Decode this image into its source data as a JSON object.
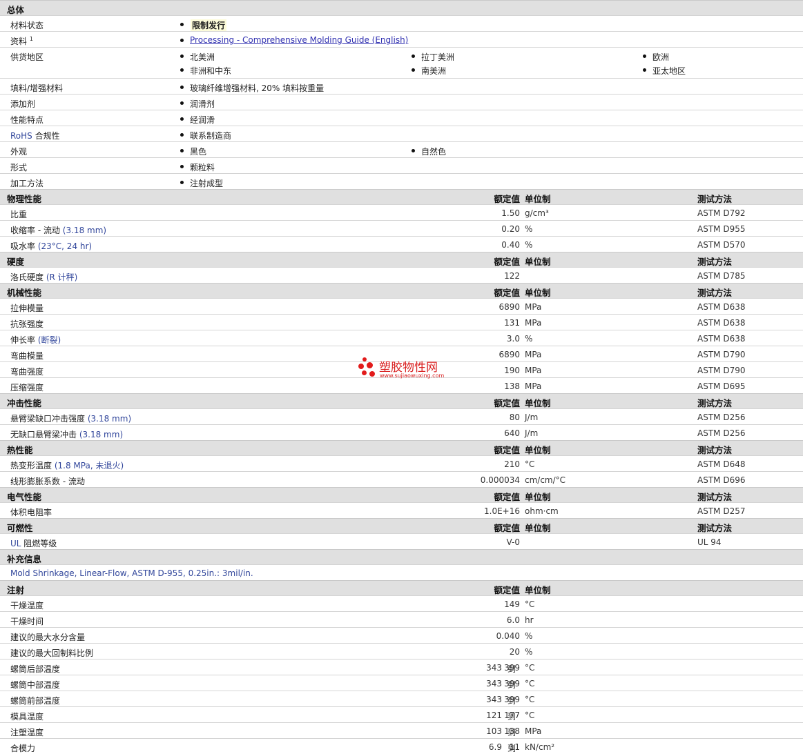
{
  "general": {
    "title": "总体",
    "rows": [
      {
        "label": "材料状态",
        "values": [
          "限制发行"
        ]
      },
      {
        "label": "资料",
        "sup": "1",
        "values": [
          "Processing - Comprehensive Molding Guide (English)"
        ]
      },
      {
        "label": "供货地区",
        "values": [
          "北美洲",
          "拉丁美洲",
          "欧洲",
          "非洲和中东",
          "南美洲",
          "亚太地区"
        ]
      },
      {
        "label": "填料/增强材料",
        "values": [
          "玻璃纤维增强材料, 20% 填料按重量"
        ]
      },
      {
        "label": "添加剂",
        "values": [
          "润滑剂"
        ]
      },
      {
        "label": "性能特点",
        "values": [
          "经润滑"
        ]
      },
      {
        "label": "RoHS 合规性",
        "label_a": "RoHS",
        "label_b": " 合规性",
        "values": [
          "联系制造商"
        ]
      },
      {
        "label": "外观",
        "values": [
          "黑色",
          "自然色"
        ]
      },
      {
        "label": "形式",
        "values": [
          "颗粒料"
        ]
      },
      {
        "label": "加工方法",
        "values": [
          "注射成型"
        ]
      }
    ]
  },
  "col_headers": {
    "value": "额定值",
    "unit": "单位制",
    "test": "测试方法"
  },
  "sections": [
    {
      "title": "物理性能",
      "has_test": true,
      "rows": [
        {
          "label": "比重",
          "value": "1.50",
          "unit": "g/cm³",
          "test": "ASTM D792"
        },
        {
          "label": "收缩率 - 流动 (3.18 mm)",
          "label_main": "收缩率 - 流动",
          "label_cond": "(3.18 mm)",
          "value": "0.20",
          "unit": "%",
          "test": "ASTM D955"
        },
        {
          "label": "吸水率 (23°C, 24 hr)",
          "label_main": "吸水率",
          "label_cond": "(23°C, 24 hr)",
          "value": "0.40",
          "unit": "%",
          "test": "ASTM D570"
        }
      ]
    },
    {
      "title": "硬度",
      "has_test": true,
      "rows": [
        {
          "label": "洛氏硬度 (R 计秤)",
          "label_main": "洛氏硬度",
          "label_cond": "(R 计秤)",
          "value": "122",
          "unit": "",
          "test": "ASTM D785"
        }
      ]
    },
    {
      "title": "机械性能",
      "has_test": true,
      "rows": [
        {
          "label": "拉伸模量",
          "value": "6890",
          "unit": "MPa",
          "test": "ASTM D638"
        },
        {
          "label": "抗张强度",
          "value": "131",
          "unit": "MPa",
          "test": "ASTM D638"
        },
        {
          "label": "伸长率 (断裂)",
          "label_main": "伸长率",
          "label_cond": "(断裂)",
          "value": "3.0",
          "unit": "%",
          "test": "ASTM D638"
        },
        {
          "label": "弯曲模量",
          "value": "6890",
          "unit": "MPa",
          "test": "ASTM D790"
        },
        {
          "label": "弯曲强度",
          "value": "190",
          "unit": "MPa",
          "test": "ASTM D790"
        },
        {
          "label": "压缩强度",
          "value": "138",
          "unit": "MPa",
          "test": "ASTM D695"
        }
      ]
    },
    {
      "title": "冲击性能",
      "has_test": true,
      "rows": [
        {
          "label": "悬臂梁缺口冲击强度 (3.18 mm)",
          "label_main": "悬臂梁缺口冲击强度",
          "label_cond": "(3.18 mm)",
          "value": "80",
          "unit": "J/m",
          "test": "ASTM D256"
        },
        {
          "label": "无缺口悬臂梁冲击 (3.18 mm)",
          "label_main": "无缺口悬臂梁冲击",
          "label_cond": "(3.18 mm)",
          "value": "640",
          "unit": "J/m",
          "test": "ASTM D256"
        }
      ]
    },
    {
      "title": "热性能",
      "has_test": true,
      "rows": [
        {
          "label": "热变形温度 (1.8 MPa, 未退火)",
          "label_main": "热变形温度",
          "label_cond": "(1.8 MPa, 未退火)",
          "value": "210",
          "unit": "°C",
          "test": "ASTM D648"
        },
        {
          "label": "线形膨胀系数 - 流动",
          "value": "0.000034",
          "unit": "cm/cm/°C",
          "test": "ASTM D696"
        }
      ]
    },
    {
      "title": "电气性能",
      "has_test": true,
      "rows": [
        {
          "label": "体积电阻率",
          "value": "1.0E+16",
          "unit": "ohm·cm",
          "test": "ASTM D257"
        }
      ]
    },
    {
      "title": "可燃性",
      "has_test": true,
      "rows": [
        {
          "label": "UL 阻燃等级",
          "label_a": "UL",
          "label_b": " 阻燃等级",
          "value": "V-0",
          "unit": "",
          "test": "UL 94"
        }
      ]
    }
  ],
  "supplement": {
    "title": "补充信息",
    "note": "Mold Shrinkage, Linear-Flow, ASTM D-955, 0.25in.: 3mil/in."
  },
  "injection": {
    "title": "注射",
    "rows": [
      {
        "label": "干燥温度",
        "value": "149",
        "unit": "°C"
      },
      {
        "label": "干燥时间",
        "value": "6.0",
        "unit": "hr"
      },
      {
        "label": "建议的最大水分含量",
        "value": "0.040",
        "unit": "%"
      },
      {
        "label": "建议的最大回制料比例",
        "value": "20",
        "unit": "%"
      },
      {
        "label": "螺筒后部温度",
        "min": "343",
        "to": "到",
        "max": "399",
        "unit": "°C"
      },
      {
        "label": "螺筒中部温度",
        "min": "343",
        "to": "到",
        "max": "399",
        "unit": "°C"
      },
      {
        "label": "螺筒前部温度",
        "min": "343",
        "to": "到",
        "max": "399",
        "unit": "°C"
      },
      {
        "label": "模具温度",
        "min": "121",
        "to": "到",
        "max": "177",
        "unit": "°C"
      },
      {
        "label": "注塑温度",
        "min": "103",
        "to": "到",
        "max": "138",
        "unit": "MPa"
      },
      {
        "label": "合模力",
        "min": "6.9",
        "to": "到",
        "max": "11",
        "unit": "kN/cm²"
      }
    ]
  },
  "watermark": {
    "title": "塑胶物性网",
    "url": "www.sujiaowuxing.com"
  },
  "colors": {
    "header_bg": "#e0e0e0",
    "link": "#2f2fb0",
    "label_blue": "#31469b",
    "watermark": "#d91f1f"
  }
}
